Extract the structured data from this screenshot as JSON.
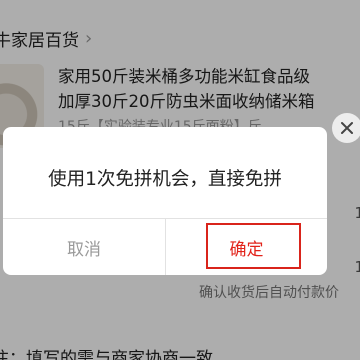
{
  "store": {
    "name": "牛家居百货",
    "chevron_icon": "chevron-right-icon"
  },
  "product": {
    "title_line1": "家用50斤装米桶多功能米缸食品级",
    "title_line2": "加厚30斤20斤防虫米面收纳储米箱",
    "spec": "15斤【实验装专业15斤面粉】斤"
  },
  "side_crop": {
    "mid": "1",
    "lower": "1"
  },
  "footnote": "确认收货后自动付款价",
  "bottom_note": "注：填写的需与商家协商一致",
  "dialog": {
    "message": "使用1次免拼机会，直接免拼",
    "cancel_label": "取消",
    "confirm_label": "确定",
    "close_icon": "close-icon"
  },
  "colors": {
    "confirm": "#e2231a",
    "highlight_box": "#d9241b",
    "overlay": "rgba(0,0,0,0.32)"
  }
}
